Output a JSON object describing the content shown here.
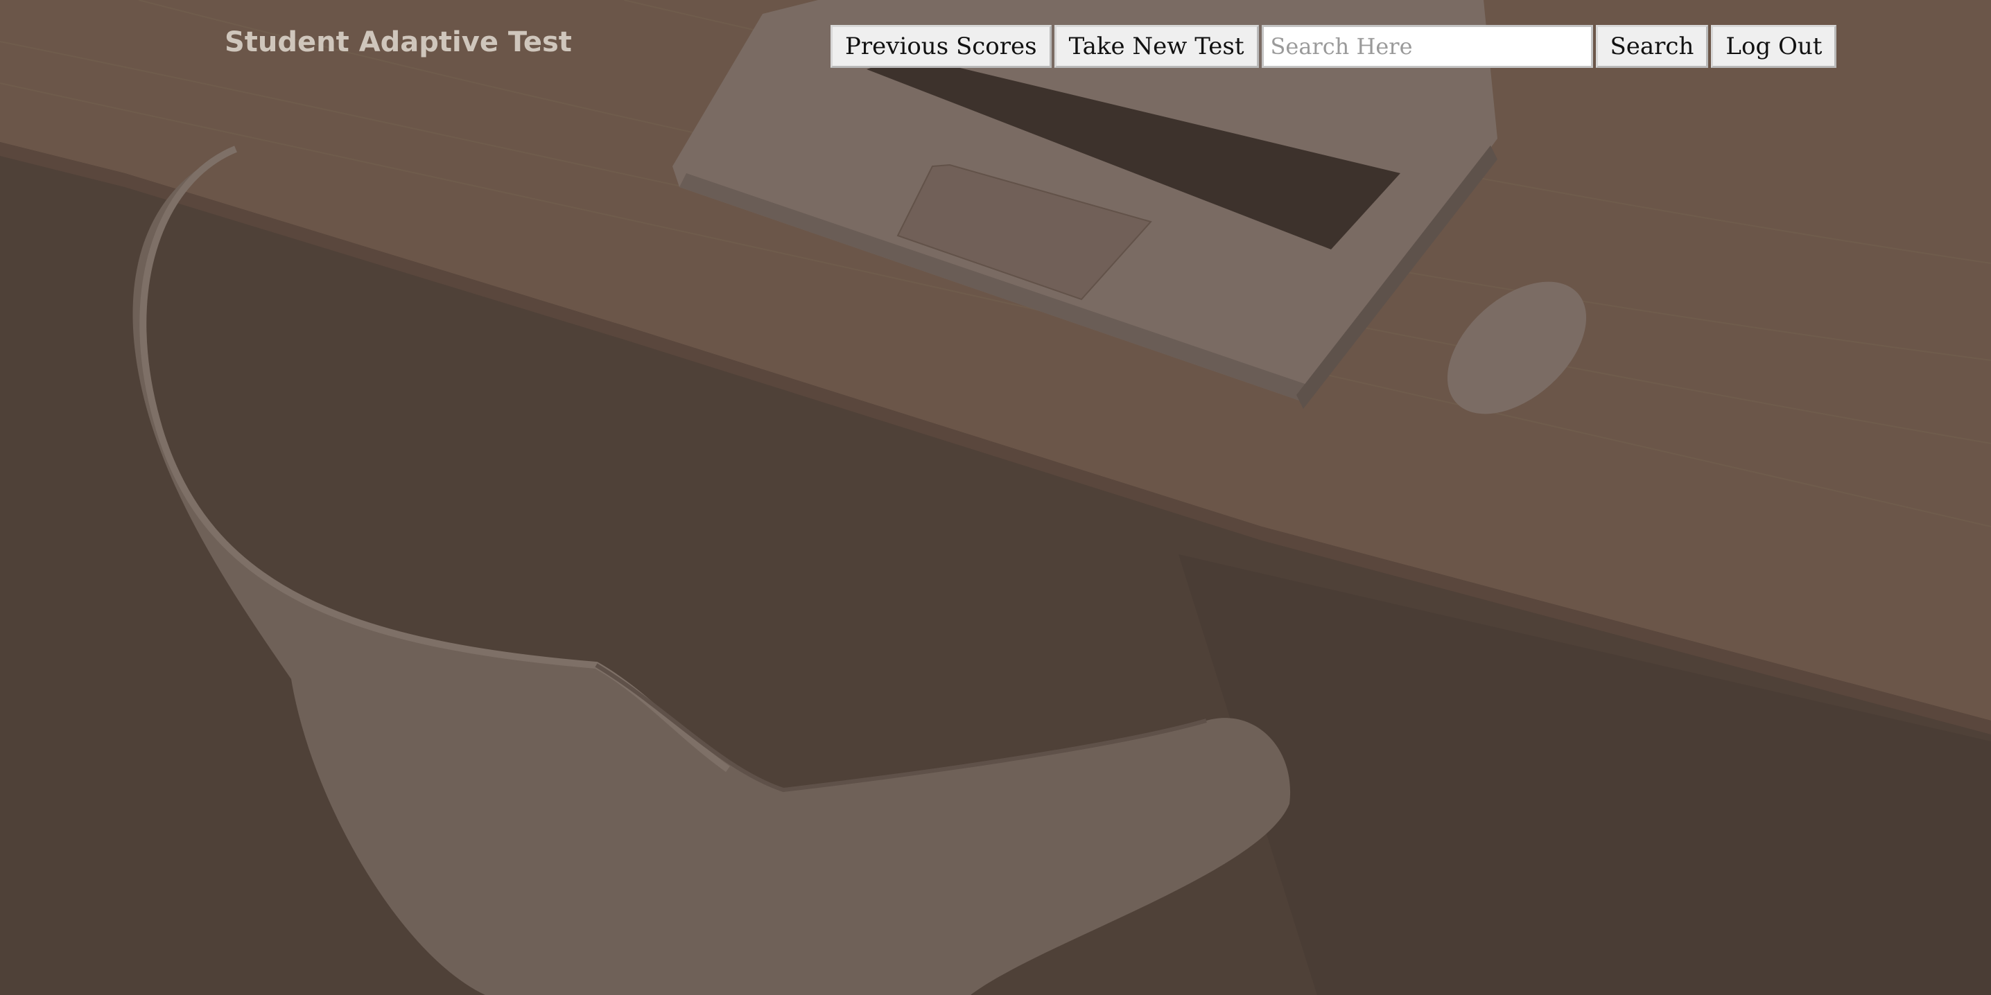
{
  "header": {
    "brand": "Student Adaptive Test",
    "nav": {
      "previous_scores_label": "Previous Scores",
      "take_new_test_label": "Take New Test",
      "search_placeholder": "Search Here",
      "search_value": "",
      "search_button_label": "Search",
      "logout_label": "Log Out"
    }
  },
  "colors": {
    "page_background": "#4f4138",
    "desk": "#6a5548",
    "brand_text": "#cfc6bc",
    "button_bg": "#efefef"
  },
  "background_scene": {
    "icons": [
      "desk-surface",
      "laptop",
      "mouse",
      "chair"
    ]
  }
}
